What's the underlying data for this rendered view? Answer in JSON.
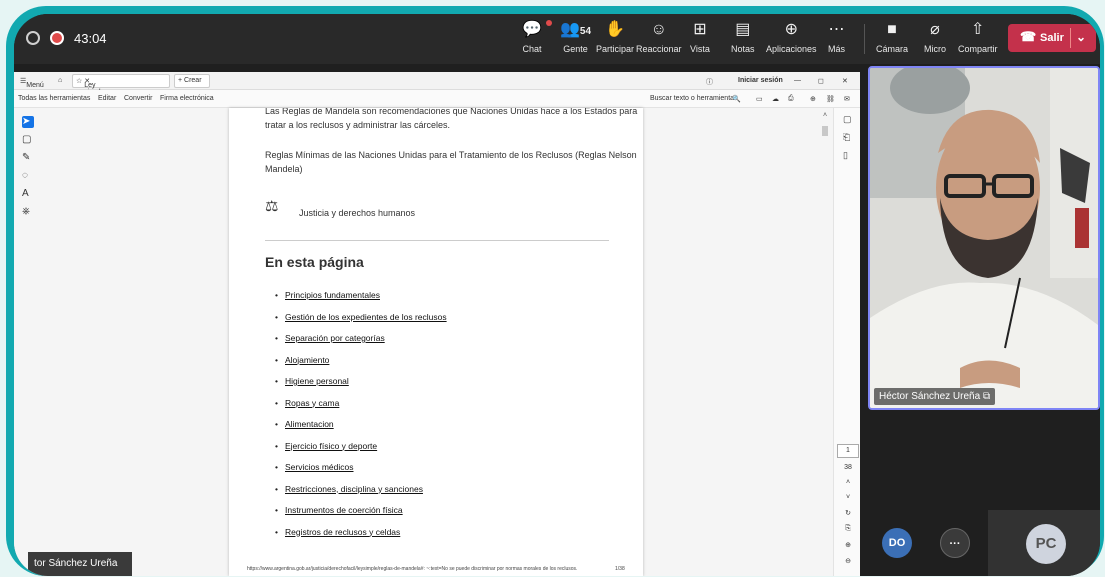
{
  "meeting": {
    "timer": "43:04",
    "toolbar": [
      {
        "label": "Chat",
        "icon": "chat-icon",
        "glyph": "💬"
      },
      {
        "label": "Gente",
        "icon": "people-icon",
        "glyph": "👥",
        "count": "54"
      },
      {
        "label": "Participar",
        "icon": "raise-hand-icon",
        "glyph": "✋"
      },
      {
        "label": "Reaccionar",
        "icon": "smile-icon",
        "glyph": "☺"
      },
      {
        "label": "Vista",
        "icon": "grid-icon",
        "glyph": "⊞"
      },
      {
        "label": "Notas",
        "icon": "notes-icon",
        "glyph": "▤"
      },
      {
        "label": "Aplicaciones",
        "icon": "apps-icon",
        "glyph": "⊕"
      },
      {
        "label": "Más",
        "icon": "more-icon",
        "glyph": "⋯"
      },
      {
        "label": "Cámara",
        "icon": "camera-off-icon",
        "glyph": "■"
      },
      {
        "label": "Micro",
        "icon": "mic-off-icon",
        "glyph": "⌀"
      },
      {
        "label": "Compartir",
        "icon": "share-icon",
        "glyph": "⇧"
      }
    ],
    "leave_label": "Salir",
    "accent": "#c4314b"
  },
  "pdf": {
    "tab_menu": "Menú",
    "tab_title": "Ley simple_ Reglas ...",
    "tab_new": "+ Crear",
    "signin": "Iniciar sesión",
    "menu": [
      "Todas las herramientas",
      "Editar",
      "Convertir",
      "Firma electrónica"
    ],
    "search_placeholder": "Buscar texto o herramientas",
    "doc": {
      "line1": "Las Reglas de Mandela son recomendaciones que Naciones Unidas hace a los Estados para",
      "line2": "tratar a los reclusos y administrar las cárceles.",
      "line3": "Reglas Mínimas de las Naciones Unidas para el Tratamiento de los Reclusos (Reglas Nelson",
      "line4": "Mandela)",
      "category": "Justicia y derechos humanos",
      "heading": "En esta página",
      "items": [
        "Principios fundamentales",
        "Gestión de los expedientes de los reclusos",
        "Separación por categorías",
        "Alojamiento",
        "Higiene personal",
        "Ropas y cama",
        "Alimentacion",
        "Ejercicio físico y deporte",
        "Servicios médicos",
        "Restricciones, disciplina y sanciones",
        "Instrumentos de coerción física",
        "Registros de reclusos y celdas"
      ],
      "footer_url": "https://www.argentina.gob.ar/justicia/derechofacil/leysimple/reglas-de-mandela#: ~:text=No se puede discriminar por normas morales de los reclusos.",
      "footer_page": "1/38"
    },
    "page_current": "1",
    "page_total": "38"
  },
  "presenter_overlay": "tor Sánchez Ureña",
  "video": {
    "name": "Héctor Sánchez Ureña"
  },
  "participants": [
    {
      "initials": "DO",
      "color": "#3b6fb6"
    },
    {
      "initials": "···",
      "color": "#444"
    }
  ],
  "pc": {
    "initials": "PC"
  }
}
